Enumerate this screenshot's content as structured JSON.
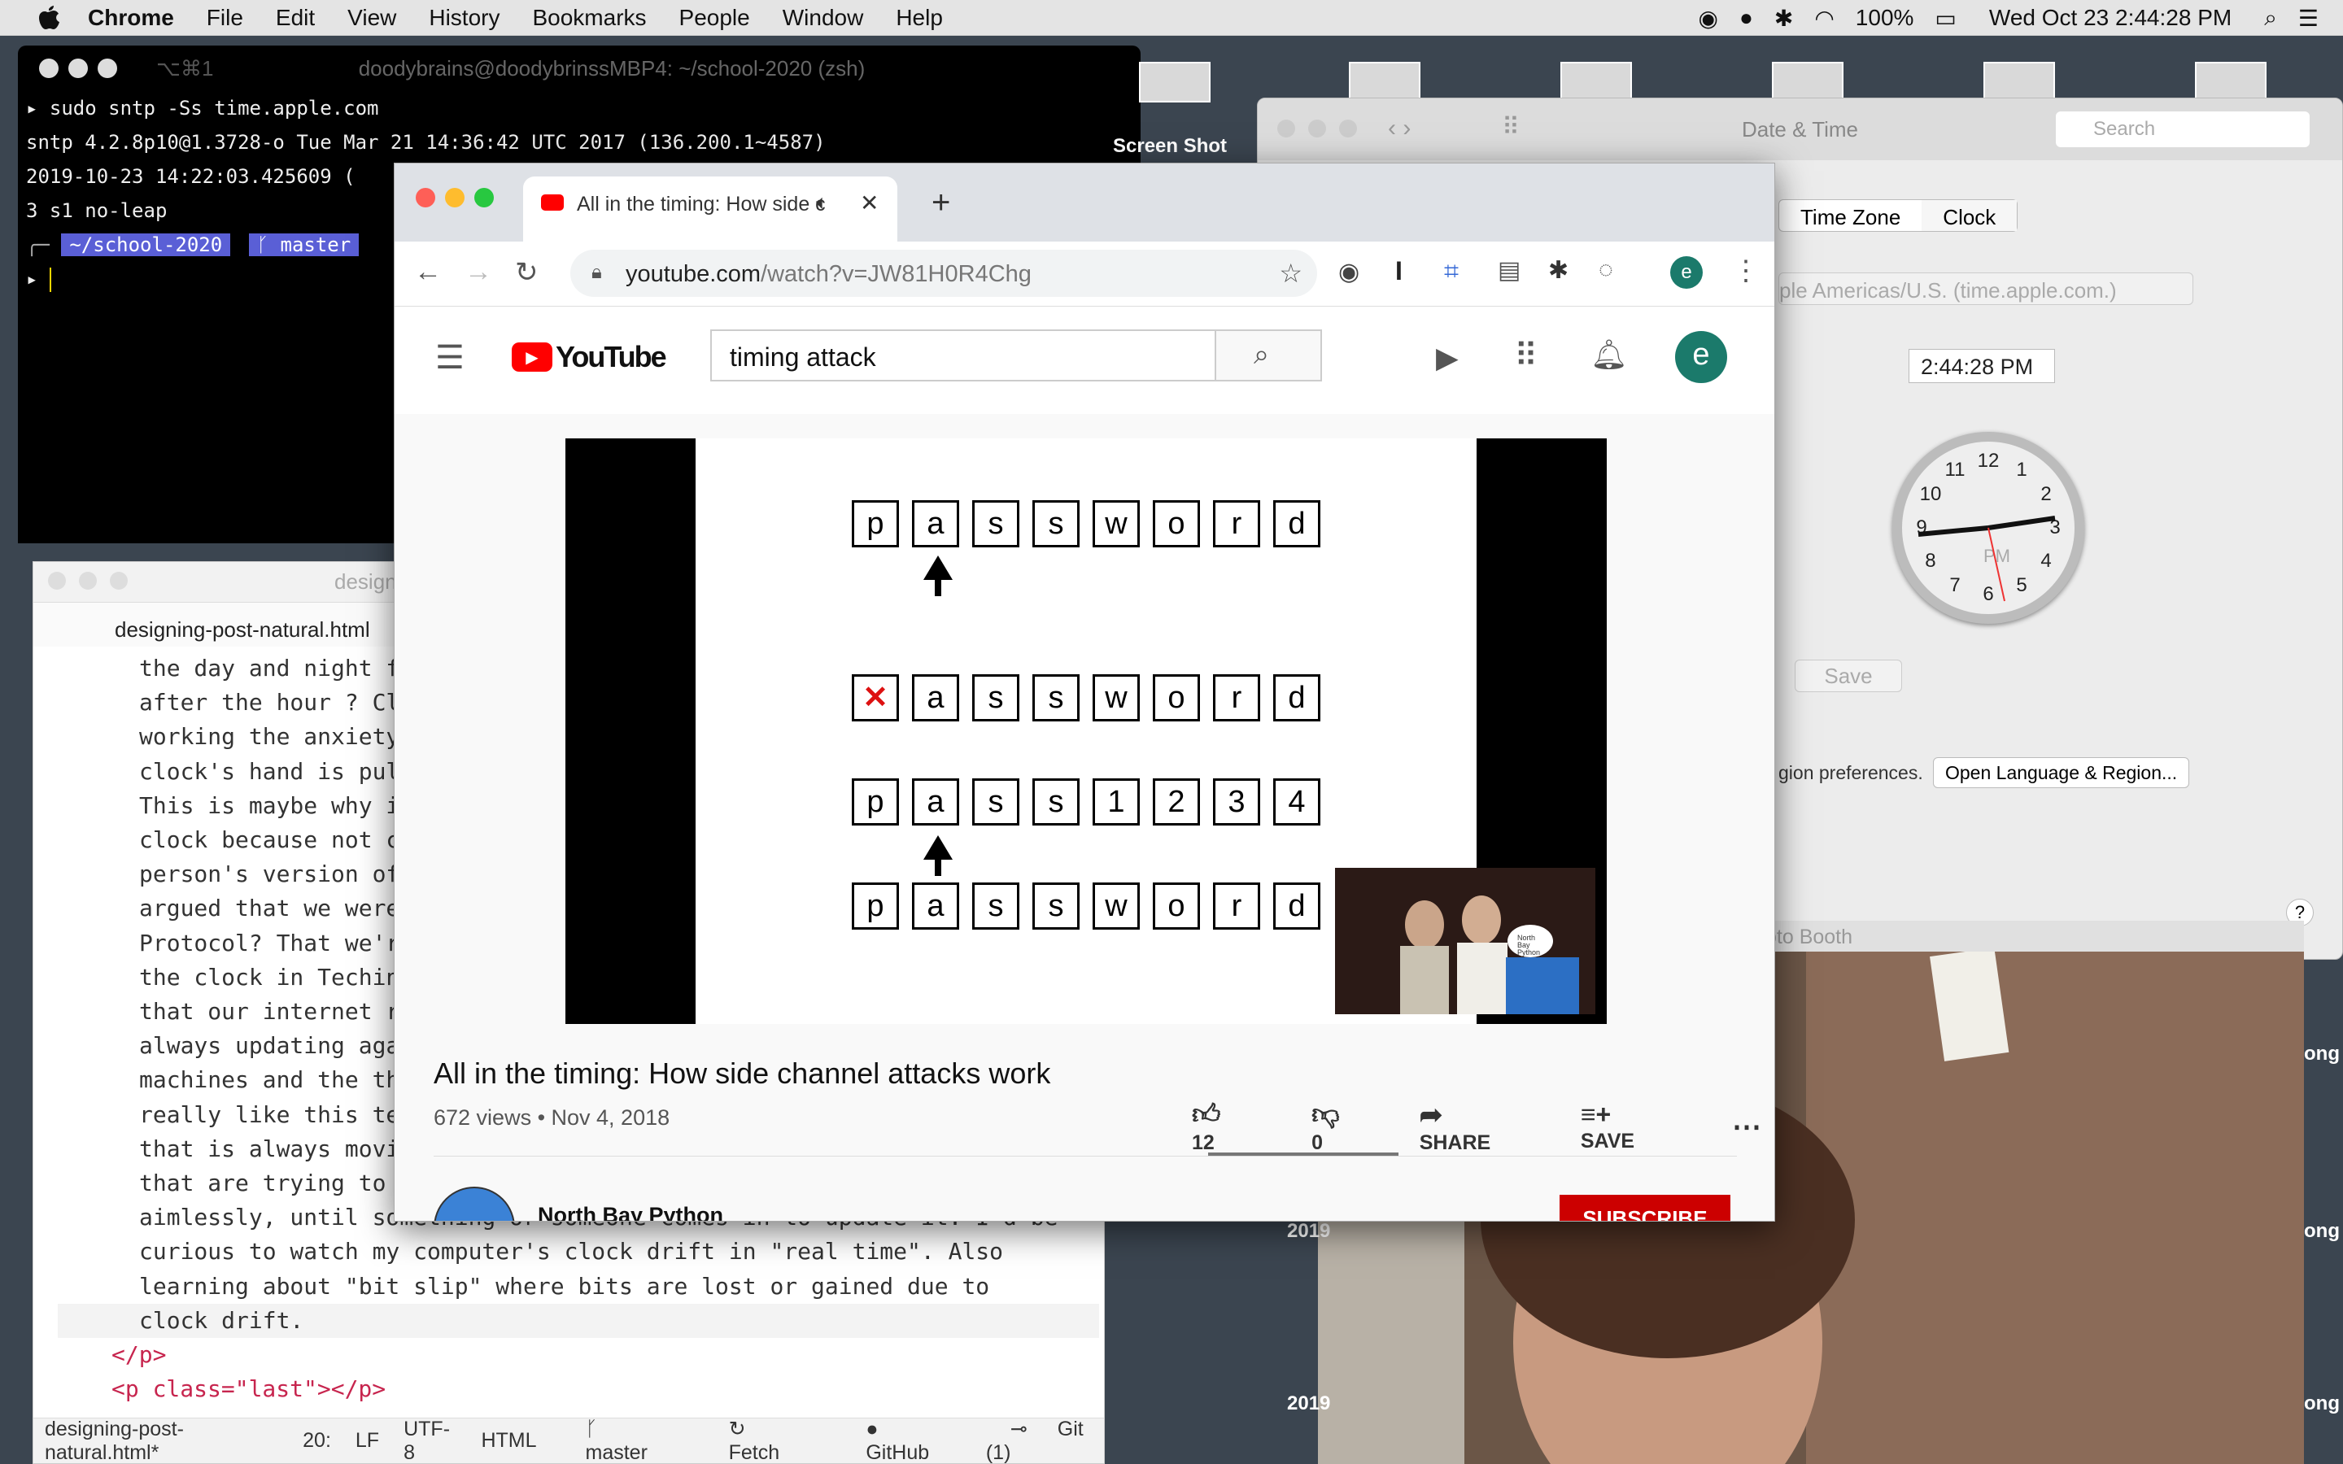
{
  "menubar": {
    "app": "Chrome",
    "items": [
      "File",
      "Edit",
      "View",
      "History",
      "Bookmarks",
      "People",
      "Window",
      "Help"
    ],
    "battery": "100%",
    "datetime": "Wed Oct 23  2:44:28 PM"
  },
  "terminal": {
    "shortcut": "⌥⌘1",
    "title": "doodybrains@doodybrinssMBP4: ~/school-2020 (zsh)",
    "lines": [
      "▸ sudo sntp -Ss time.apple.com",
      "sntp 4.2.8p10@1.3728-o Tue Mar 21 14:36:42 UTC 2017 (136.200.1~4587)",
      "2019-10-23 14:22:03.425609 (",
      "3 s1 no-leap"
    ],
    "prompt_dir": "~/school-2020",
    "prompt_branch": "ᚴ master"
  },
  "editor": {
    "window_title": "design",
    "tab": "designing-post-natural.html",
    "code_lines": [
      "the day and night f",
      "after the hour ? Cl",
      "working the anxiety",
      "clock's hand is pul",
      "This is maybe why i",
      "clock because not c",
      "person's version of",
      "argued that we were",
      "Protocol? That we'r",
      "the clock in Techin",
      "that our internet r",
      "always updating aga",
      "machines and the th",
      "really like this te",
      "that is always movi",
      "that are trying to ",
      "aimlessly, until something or someone comes in to update it. I'd be",
      "curious to watch my computer's clock drift in \"real time\". Also",
      "learning about \"bit slip\" where bits are lost or gained due to",
      "clock drift."
    ],
    "close_p": "</p>",
    "last_p": "<p class=\"last\"></p>",
    "status": {
      "file": "designing-post-natural.html*",
      "pos": "20:",
      "eol": "LF",
      "enc": "UTF-8",
      "grammar": "HTML",
      "branch": "master",
      "fetch": "Fetch",
      "github": "GitHub",
      "git": "Git (1)"
    }
  },
  "screenshot_label": "Screen Shot",
  "datetime_prefs": {
    "title": "Date & Time",
    "search_placeholder": "Search",
    "tabs": [
      "Time Zone",
      "Clock"
    ],
    "server": "ple Americas/U.S. (time.apple.com.)",
    "time_value": "2:44:28 PM",
    "clock_numbers": [
      "12",
      "1",
      "2",
      "3",
      "4",
      "5",
      "6",
      "7",
      "8",
      "9",
      "10",
      "11"
    ],
    "clock_pm": "PM",
    "save": "Save",
    "region_text": "gion preferences.",
    "open_region": "Open Language & Region...",
    "help": "?"
  },
  "photobooth": {
    "title": "oto Booth"
  },
  "side_labels": [
    "ong",
    "ong",
    "ong"
  ],
  "year_labels": [
    "2019",
    "2019"
  ],
  "chrome": {
    "tab_title": "All in the timing: How side c",
    "url_host": "youtube.com",
    "url_path": "/watch?v=JW81H0R4Chg",
    "profile": "e"
  },
  "youtube": {
    "logo": "YouTube",
    "search_value": "timing attack",
    "avatar": "e",
    "slide_rows": [
      [
        "p",
        "a",
        "s",
        "s",
        "w",
        "o",
        "r",
        "d"
      ],
      [
        "✕",
        "a",
        "s",
        "s",
        "w",
        "o",
        "r",
        "d"
      ],
      [
        "p",
        "a",
        "s",
        "s",
        "1",
        "2",
        "3",
        "4"
      ],
      [
        "p",
        "a",
        "s",
        "s",
        "w",
        "o",
        "r",
        "d"
      ]
    ],
    "pip_sign": "North Bay Python",
    "video_title": "All in the timing: How side channel attacks work",
    "views": "672 views • Nov 4, 2018",
    "likes": "12",
    "dislikes": "0",
    "share": "SHARE",
    "save": "SAVE",
    "channel": "North Bay Python",
    "subscribe": "SUBSCRIBE"
  }
}
